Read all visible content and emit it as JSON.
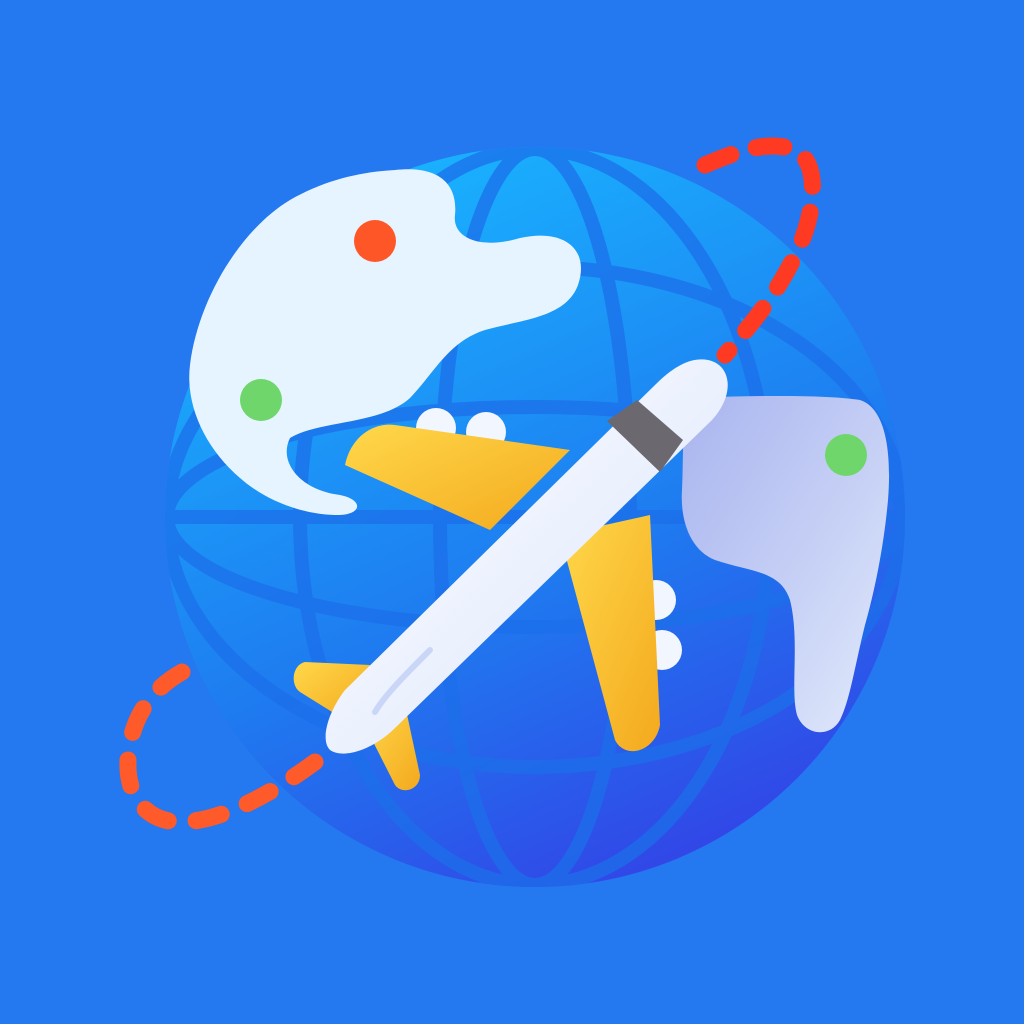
{
  "icon": {
    "kind": "travel-app-icon",
    "elements": [
      "globe",
      "continents",
      "airplane",
      "flight-path",
      "location-markers"
    ]
  },
  "colors": {
    "background": "#2478F0",
    "globe_light": "#19B4FF",
    "globe_dark": "#3440E6",
    "grid_line": "#1C72EE",
    "continent": "#E6F4FF",
    "continent_shadow": "#B8BFF0",
    "plane_body": "#F2F6FF",
    "plane_body_shade": "#BFD0F7",
    "plane_wing": "#FFC12E",
    "plane_wing_dark": "#F0A21A",
    "plane_window": "#6B6870",
    "flight_path": "#FF5A2A",
    "marker_red": "#FF5628",
    "marker_green": "#6ED66A"
  }
}
